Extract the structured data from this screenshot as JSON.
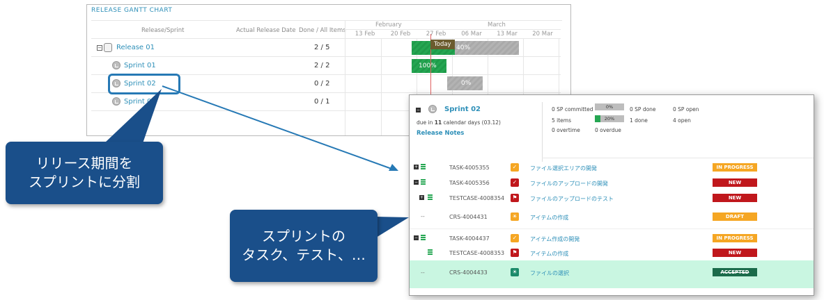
{
  "gantt": {
    "title": "RELEASE GANTT CHART",
    "columns": {
      "release_sprint": "Release/Sprint",
      "actual_date": "Actual Release Date",
      "done_all": "Done / All Items"
    },
    "months": [
      "February",
      "March"
    ],
    "weeks": [
      "13 Feb",
      "20 Feb",
      "27 Feb",
      "06 Mar",
      "13 Mar",
      "20 Mar"
    ],
    "today_label": "Today",
    "rows": [
      {
        "name": "Release 01",
        "count": "2 / 5",
        "bar_label": "40%",
        "progress": 0.4
      },
      {
        "name": "Sprint 01",
        "count": "2 / 2",
        "bar_label": "100%",
        "progress": 1.0
      },
      {
        "name": "Sprint 02",
        "count": "0 / 2",
        "bar_label": "0%",
        "progress": 0.0
      },
      {
        "name": "Sprint 03",
        "count": "0 / 1"
      }
    ]
  },
  "detail": {
    "sprint_name": "Sprint 02",
    "due_prefix": "due in ",
    "due_days": "11",
    "due_suffix": " calendar days (03.12)",
    "release_notes": "Release Notes",
    "stats": {
      "committed": "0 SP committed",
      "committed_pct": "0%",
      "done_sp": "0 SP done",
      "open_sp": "0 SP open",
      "items": "5 items",
      "items_pct": "20%",
      "items_progress": 0.2,
      "done_items": "1 done",
      "open_items": "4 open",
      "overtime": "0 overtime",
      "overdue": "0 overdue"
    },
    "tasks": [
      {
        "id": "TASK-4005355",
        "title": "ファイル選択エリアの開発",
        "status": "IN PROGRESS",
        "status_color": "#f5a623",
        "icon": "check-icon",
        "icon_color": "#f5a623"
      },
      {
        "id": "TASK-4005356",
        "title": "ファイルのアップロードの開発",
        "status": "NEW",
        "status_color": "#c0171c",
        "icon": "check-icon",
        "icon_color": "#c0171c"
      },
      {
        "id": "TESTCASE-4008354",
        "title": "ファイルのアップロードのテスト",
        "status": "NEW",
        "status_color": "#c0171c",
        "icon": "flag-icon",
        "icon_color": "#c0171c"
      },
      {
        "id": "CRS-4004431",
        "title": "アイテムの作成",
        "status": "DRAFT",
        "status_color": "#f5a623",
        "icon": "bulb-icon",
        "icon_color": "#f5a623"
      },
      {
        "id": "TASK-4004437",
        "title": "アイテム作成の開発",
        "status": "IN PROGRESS",
        "status_color": "#f5a623",
        "icon": "check-icon",
        "icon_color": "#f5a623"
      },
      {
        "id": "TESTCASE-4008353",
        "title": "アイテムの作成",
        "status": "NEW",
        "status_color": "#c0171c",
        "icon": "flag-icon",
        "icon_color": "#c0171c"
      },
      {
        "id": "CRS-4004433",
        "title": "ファイルの選択",
        "status": "ACCEPTED",
        "status_color": "#1b6b4a",
        "icon": "bulb-icon",
        "icon_color": "#1b8a6a"
      }
    ]
  },
  "callouts": {
    "release": [
      "リリース期間を",
      "スプリントに分割"
    ],
    "sprint": [
      "スプリントの",
      "タスク、テスト、…"
    ]
  }
}
